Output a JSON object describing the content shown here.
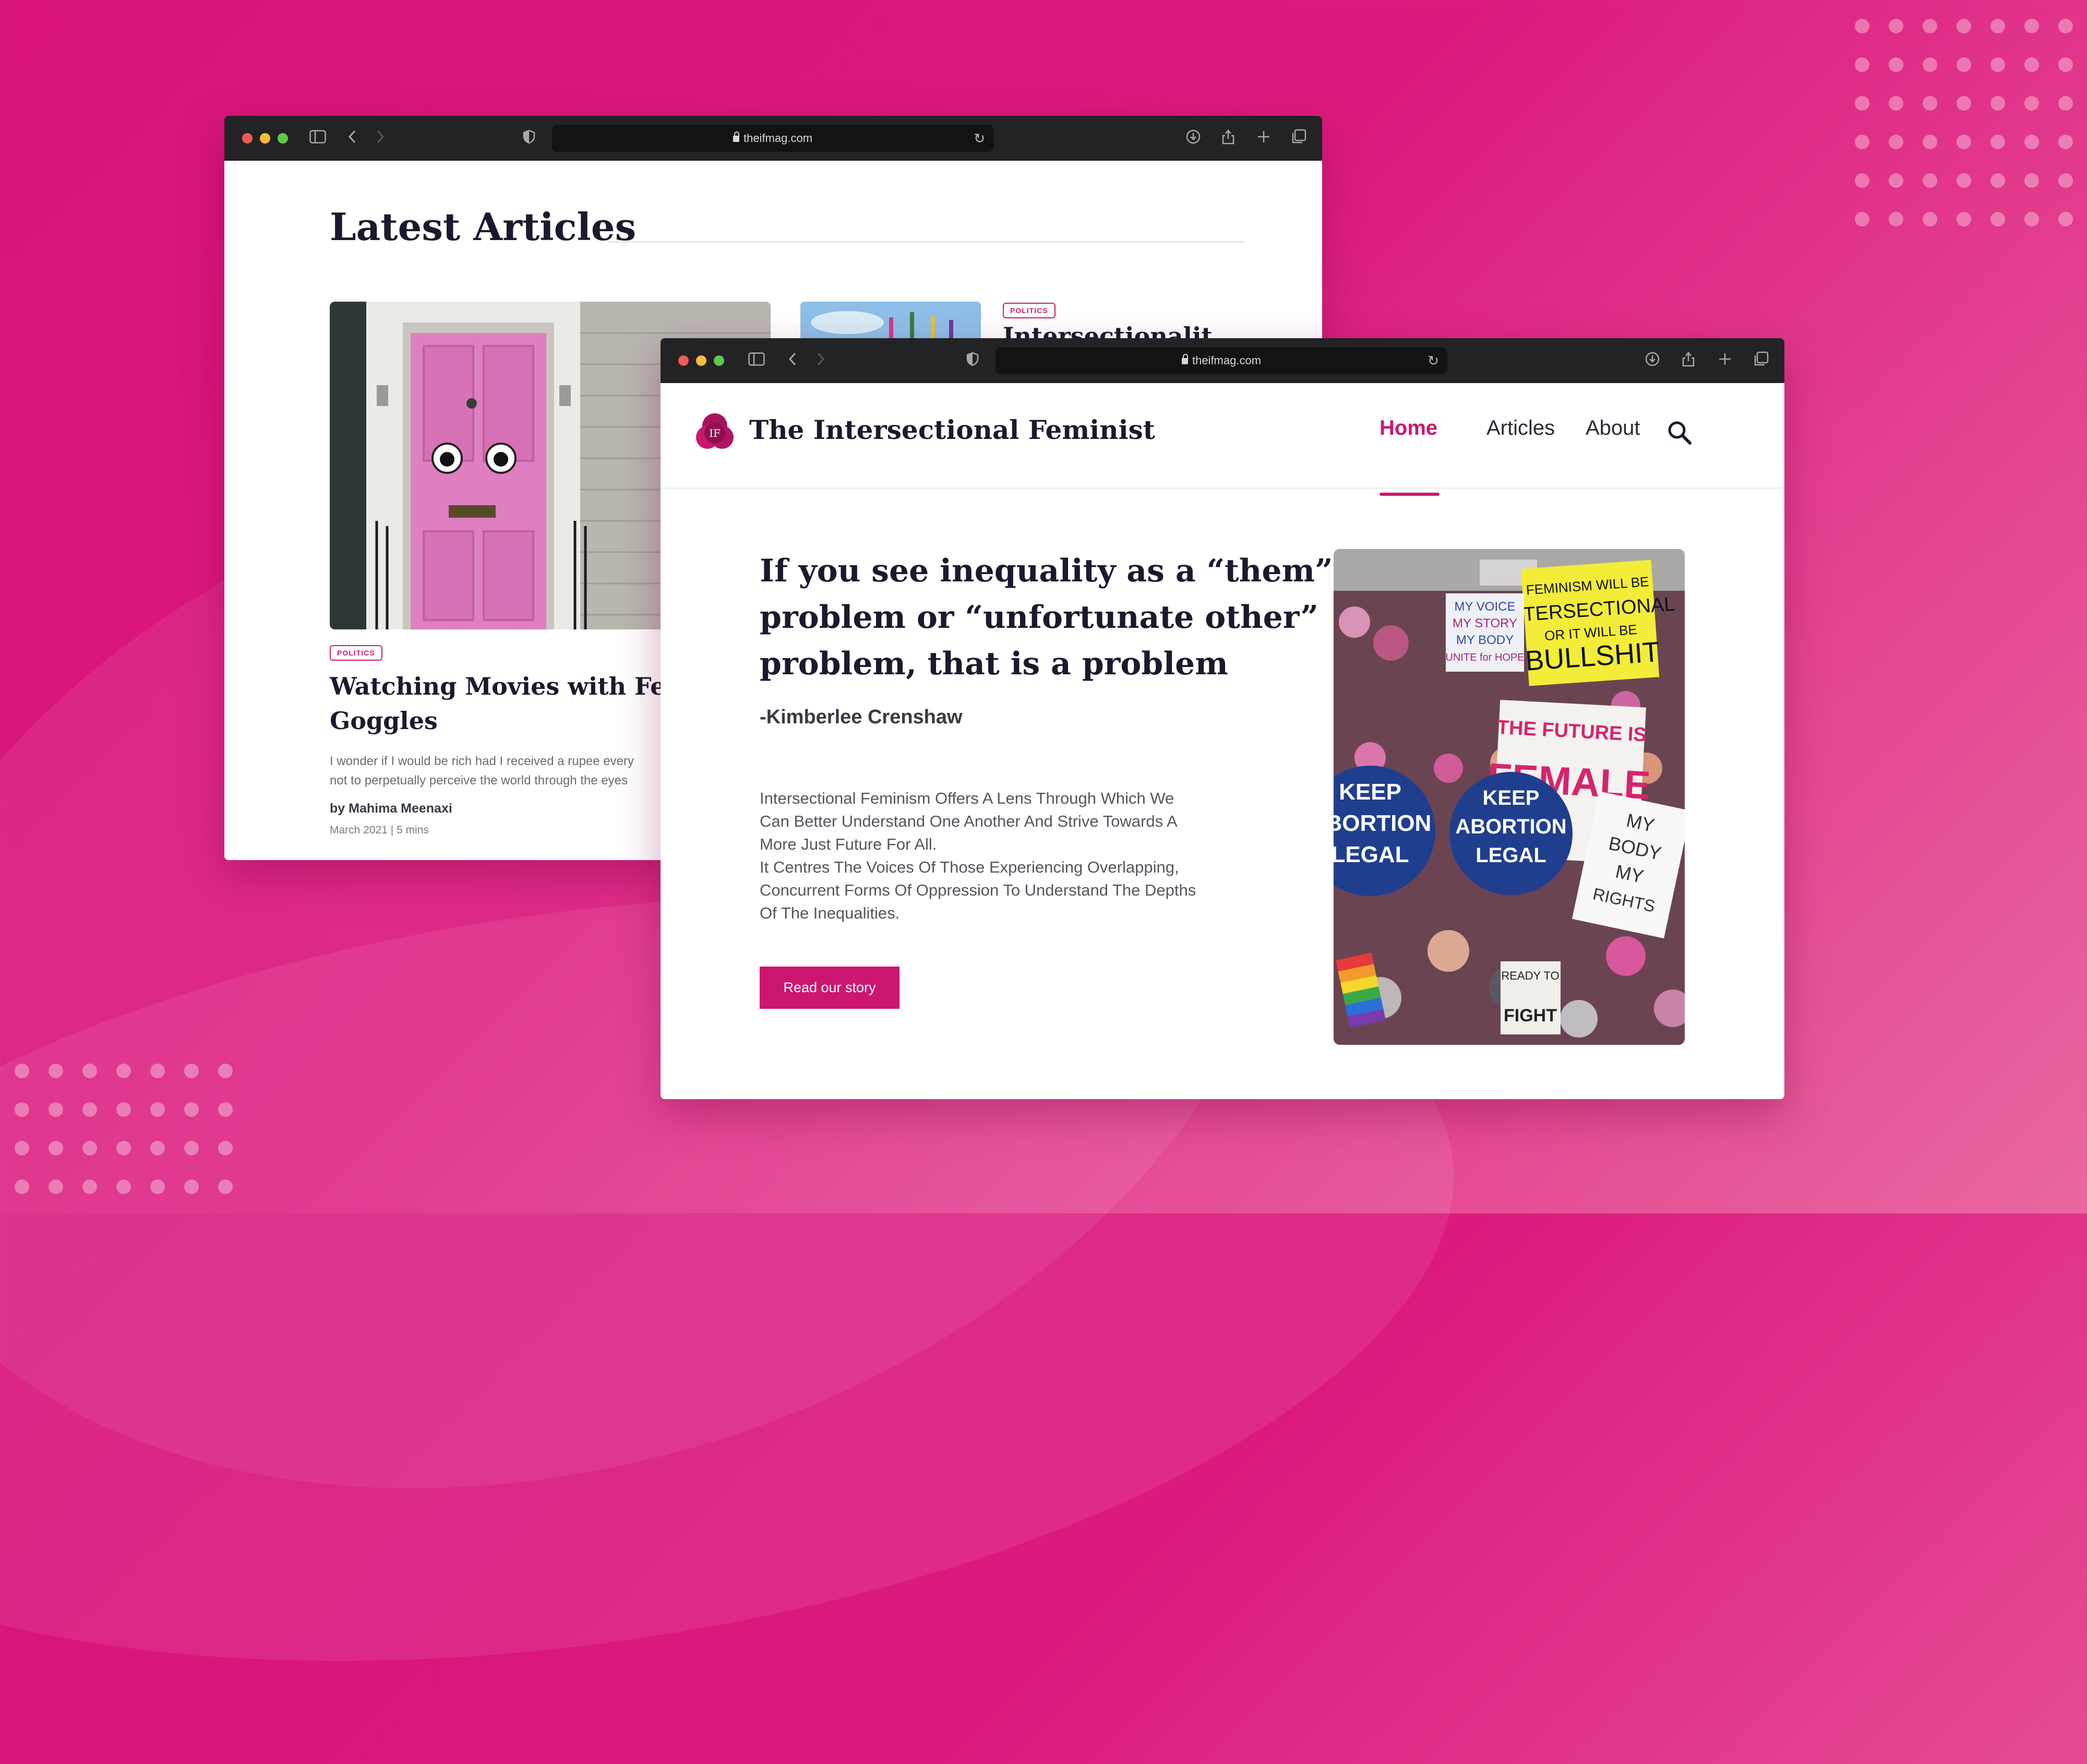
{
  "back_window": {
    "url": "theifmag.com",
    "section_title": "Latest Articles",
    "featured_article": {
      "category": "POLITICS",
      "title_line1": "Watching Movies with Femini",
      "title_line2": "Goggles",
      "excerpt_line1": "I wonder if I would be rich had I received a rupee every",
      "excerpt_line2": "not to perpetually perceive the world through the eyes",
      "author": "by Mahima Meenaxi",
      "meta": "March 2021 | 5 mins"
    },
    "second_article": {
      "category": "POLITICS",
      "title_partial": "Intersectionalit..."
    }
  },
  "front_window": {
    "url": "theifmag.com",
    "brand": {
      "logo_text": "IF",
      "name": "The Intersectional Feminist"
    },
    "nav": [
      {
        "label": "Home",
        "active": true
      },
      {
        "label": "Articles",
        "active": false
      },
      {
        "label": "About",
        "active": false
      }
    ],
    "hero": {
      "quote_line1": "If you see inequality as a “them”",
      "quote_line2": "problem or “unfortunate other”",
      "quote_line3": "problem, that is a problem",
      "quote_author": "-Kimberlee Crenshaw",
      "body_line1": "Intersectional Feminism Offers A Lens Through Which We",
      "body_line2": "Can Better Understand One Another And Strive Towards A",
      "body_line3": "More Just Future For All.",
      "body_line4": "It Centres The Voices Of Those Experiencing Overlapping,",
      "body_line5": "Concurrent Forms Of Oppression To Understand The Depths",
      "body_line6": "Of The Inequalities.",
      "cta_label": "Read our story"
    },
    "protest_signs": {
      "sign1_l1": "FEMINISM WILL BE",
      "sign1_l2": "INTERSECTIONAL",
      "sign1_l3": "OR IT WILL BE",
      "sign1_l4": "BULLSHIT",
      "sign2_l1": "MY VOICE",
      "sign2_l2": "MY STORY",
      "sign2_l3": "MY BODY",
      "sign2_l4": "UNITE for HOPE",
      "sign3_l1": "THE FUTURE IS",
      "sign3_l2": "FEMALE",
      "sign4_l1": "KEEP",
      "sign4_l2": "ABORTION",
      "sign4_l3": "LEGAL",
      "sign5_l1": "MY",
      "sign5_l2": "BODY",
      "sign5_l3": "MY",
      "sign5_l4": "RIGHTS",
      "sign6_l1": "READY TO",
      "sign6_l2": "FIGHT"
    }
  },
  "colors": {
    "brand": "#cc1670",
    "background": "#d8127a",
    "browser_chrome": "#232325",
    "heading": "#1a1a2e"
  }
}
